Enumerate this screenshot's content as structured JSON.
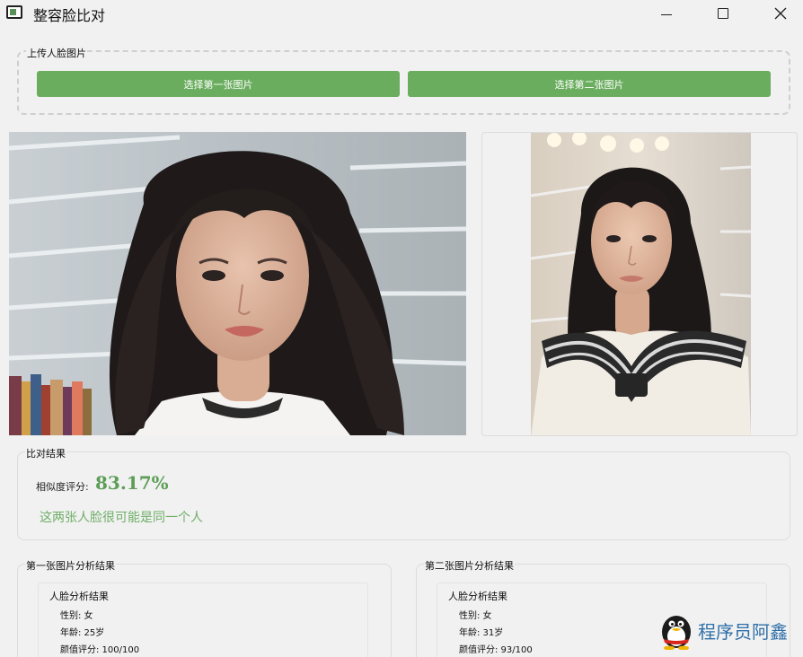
{
  "window": {
    "title": "整容脸比对"
  },
  "upload": {
    "group_title": "上传人脸图片",
    "button_first": "选择第一张图片",
    "button_second": "选择第二张图片"
  },
  "result": {
    "group_title": "比对结果",
    "similarity_label": "相似度评分:",
    "similarity_value": "83.17%",
    "verdict": "这两张人脸很可能是同一个人",
    "accent_color": "#6aad5e"
  },
  "analysis_first": {
    "group_title": "第一张图片分析结果",
    "section_title": "人脸分析结果",
    "gender": "性别: 女",
    "age": "年龄: 25岁",
    "beauty": "颜值评分: 100/100"
  },
  "analysis_second": {
    "group_title": "第二张图片分析结果",
    "section_title": "人脸分析结果",
    "gender": "性别: 女",
    "age": "年龄: 31岁",
    "beauty": "颜值评分: 93/100"
  },
  "watermark": {
    "text": "程序员阿鑫"
  }
}
